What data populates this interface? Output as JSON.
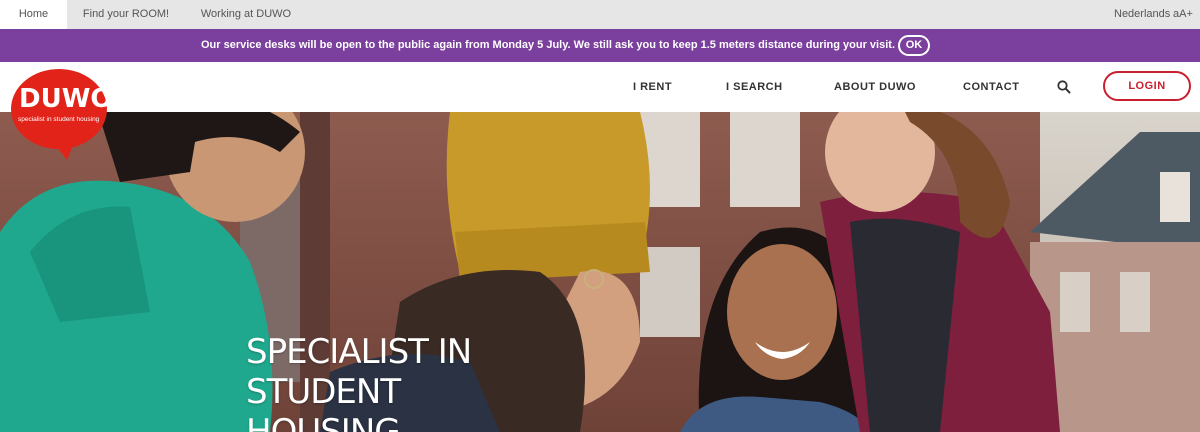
{
  "topbar": {
    "tabs": [
      {
        "label": "Home",
        "active": true
      },
      {
        "label": "Find your ROOM!",
        "active": false
      },
      {
        "label": "Working at DUWO",
        "active": false
      }
    ],
    "language_label": "Nederlands",
    "text_size_label": "aA+"
  },
  "notice": {
    "message": "Our service desks will be open to the public again from Monday 5 July. We still ask you to keep 1.5 meters distance during your visit.",
    "ok_label": "OK",
    "background_color": "#7b3f9d"
  },
  "logo": {
    "wordmark": "DUWO",
    "tagline": "specialist in student housing",
    "color": "#e2231a"
  },
  "nav": {
    "items": [
      {
        "label": "I RENT"
      },
      {
        "label": "I SEARCH"
      },
      {
        "label": "ABOUT DUWO"
      },
      {
        "label": "CONTACT"
      }
    ],
    "search_icon": "search-icon",
    "login_label": "LOGIN",
    "accent_color": "#c8202f"
  },
  "hero": {
    "title": "Specialist in student housing"
  }
}
